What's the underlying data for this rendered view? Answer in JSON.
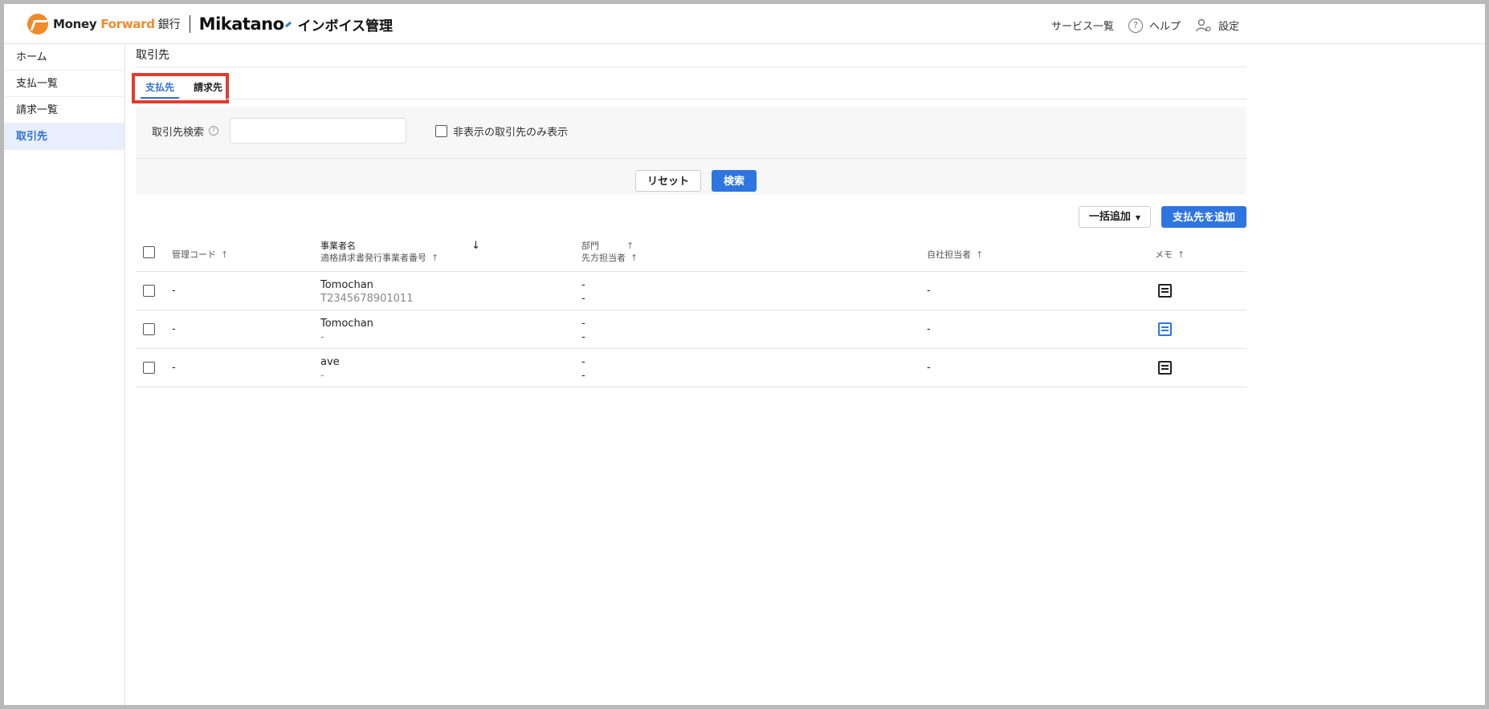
{
  "header": {
    "brand_money": "Money",
    "brand_forward": "Forward",
    "brand_bank": "銀行",
    "brand_mikatano": "Mikatano",
    "product": "インボイス管理",
    "services": "サービス一覧",
    "help": "ヘルプ",
    "settings": "設定"
  },
  "sidebar": {
    "items": [
      {
        "label": "ホーム"
      },
      {
        "label": "支払一覧"
      },
      {
        "label": "請求一覧"
      },
      {
        "label": "取引先"
      }
    ]
  },
  "page": {
    "title": "取引先",
    "tabs": [
      {
        "label": "支払先"
      },
      {
        "label": "請求先"
      }
    ]
  },
  "search": {
    "label": "取引先検索",
    "help": "?",
    "value": "",
    "hidden_only_label": "非表示の取引先のみ表示",
    "reset": "リセット",
    "submit": "検索"
  },
  "actions": {
    "bulk_add": "一括追加",
    "add": "支払先を追加"
  },
  "table": {
    "headers": {
      "code": "管理コード",
      "name": "事業者名",
      "reg_no": "適格請求書発行事業者番号",
      "dept": "部門",
      "contact": "先方担当者",
      "staff": "自社担当者",
      "memo": "メモ"
    },
    "rows": [
      {
        "code": "-",
        "name": "Tomochan",
        "reg_no": "T2345678901011",
        "dept": "-",
        "contact": "-",
        "staff": "-",
        "memo": "memo-icon"
      },
      {
        "code": "-",
        "name": "Tomochan",
        "reg_no": "-",
        "dept": "-",
        "contact": "-",
        "staff": "-",
        "memo": "memo-icon-blue"
      },
      {
        "code": "-",
        "name": "ave",
        "reg_no": "-",
        "dept": "-",
        "contact": "-",
        "staff": "-",
        "memo": "memo-icon"
      }
    ]
  }
}
